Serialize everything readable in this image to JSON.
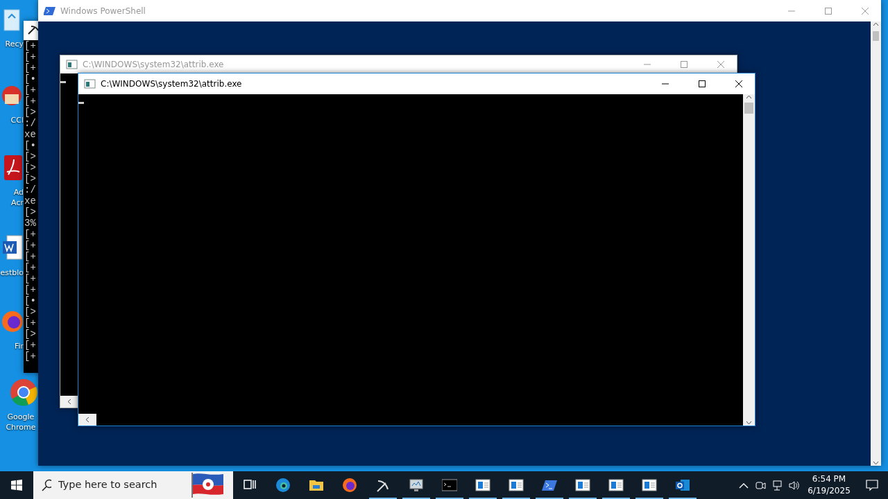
{
  "desktop_icons": [
    {
      "kind": "recycle",
      "label_lines": [
        "Recy"
      ]
    },
    {
      "kind": "ccleaner",
      "label_lines": [
        "CCl"
      ]
    },
    {
      "kind": "acrobat",
      "label_lines": [
        "Ad",
        "Acr"
      ]
    },
    {
      "kind": "word",
      "label_lines": [
        "estblo"
      ]
    },
    {
      "kind": "firefox",
      "label_lines": [
        "Fir"
      ]
    },
    {
      "kind": "chrome",
      "label_lines": [
        "Google",
        "Chrome"
      ]
    }
  ],
  "console_behind": {
    "lines": [
      "[+",
      "[+",
      "[+",
      "[•",
      "[+",
      "[+",
      "[>",
      ":/",
      "xe",
      "[•",
      "[>",
      "[>",
      "[>",
      ":/",
      "xe",
      "[>",
      "3%",
      "[+",
      "[+",
      "[+",
      "[+",
      "[+",
      "[+",
      "[•",
      "[>",
      "[+",
      "[>",
      "[+",
      "[+"
    ]
  },
  "powershell_window": {
    "title": "Windows PowerShell"
  },
  "attrib_windows": [
    {
      "title": "C:\\WINDOWS\\system32\\attrib.exe",
      "active": false
    },
    {
      "title": "C:\\WINDOWS\\system32\\attrib.exe",
      "active": true
    }
  ],
  "taskbar": {
    "search": {
      "placeholder": "Type here to search"
    },
    "apps": [
      {
        "kind": "taskview",
        "running": false
      },
      {
        "kind": "edge",
        "running": false
      },
      {
        "kind": "explorer",
        "running": false
      },
      {
        "kind": "firefox",
        "running": false
      },
      {
        "kind": "pickaxe",
        "running": true
      },
      {
        "kind": "monitor",
        "running": true
      },
      {
        "kind": "cmd",
        "running": true
      },
      {
        "kind": "window",
        "running": true
      },
      {
        "kind": "window",
        "running": true
      },
      {
        "kind": "powershell",
        "running": true
      },
      {
        "kind": "window",
        "running": true
      },
      {
        "kind": "window",
        "running": true
      },
      {
        "kind": "window",
        "running": true
      },
      {
        "kind": "outlook",
        "running": true
      }
    ],
    "time": "6:54 PM",
    "date": "6/19/2025"
  }
}
